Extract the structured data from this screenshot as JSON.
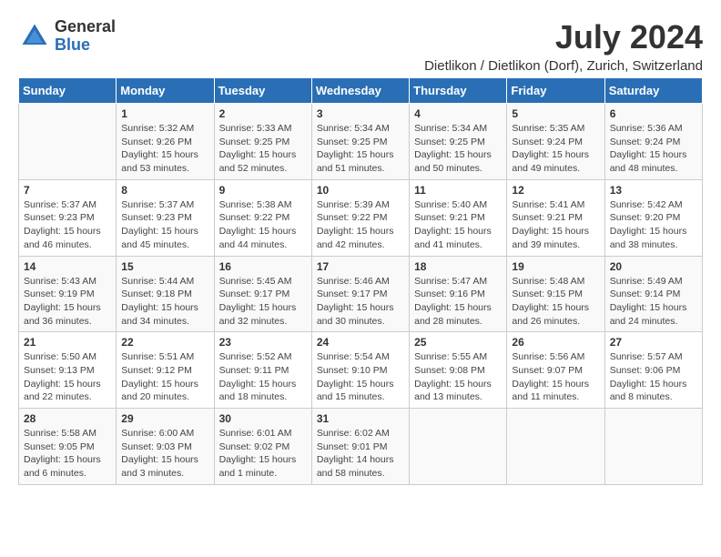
{
  "header": {
    "logo_general": "General",
    "logo_blue": "Blue",
    "title": "July 2024",
    "subtitle": "Dietlikon / Dietlikon (Dorf), Zurich, Switzerland"
  },
  "days_of_week": [
    "Sunday",
    "Monday",
    "Tuesday",
    "Wednesday",
    "Thursday",
    "Friday",
    "Saturday"
  ],
  "weeks": [
    [
      {
        "day": "",
        "content": ""
      },
      {
        "day": "1",
        "content": "Sunrise: 5:32 AM\nSunset: 9:26 PM\nDaylight: 15 hours\nand 53 minutes."
      },
      {
        "day": "2",
        "content": "Sunrise: 5:33 AM\nSunset: 9:25 PM\nDaylight: 15 hours\nand 52 minutes."
      },
      {
        "day": "3",
        "content": "Sunrise: 5:34 AM\nSunset: 9:25 PM\nDaylight: 15 hours\nand 51 minutes."
      },
      {
        "day": "4",
        "content": "Sunrise: 5:34 AM\nSunset: 9:25 PM\nDaylight: 15 hours\nand 50 minutes."
      },
      {
        "day": "5",
        "content": "Sunrise: 5:35 AM\nSunset: 9:24 PM\nDaylight: 15 hours\nand 49 minutes."
      },
      {
        "day": "6",
        "content": "Sunrise: 5:36 AM\nSunset: 9:24 PM\nDaylight: 15 hours\nand 48 minutes."
      }
    ],
    [
      {
        "day": "7",
        "content": "Sunrise: 5:37 AM\nSunset: 9:23 PM\nDaylight: 15 hours\nand 46 minutes."
      },
      {
        "day": "8",
        "content": "Sunrise: 5:37 AM\nSunset: 9:23 PM\nDaylight: 15 hours\nand 45 minutes."
      },
      {
        "day": "9",
        "content": "Sunrise: 5:38 AM\nSunset: 9:22 PM\nDaylight: 15 hours\nand 44 minutes."
      },
      {
        "day": "10",
        "content": "Sunrise: 5:39 AM\nSunset: 9:22 PM\nDaylight: 15 hours\nand 42 minutes."
      },
      {
        "day": "11",
        "content": "Sunrise: 5:40 AM\nSunset: 9:21 PM\nDaylight: 15 hours\nand 41 minutes."
      },
      {
        "day": "12",
        "content": "Sunrise: 5:41 AM\nSunset: 9:21 PM\nDaylight: 15 hours\nand 39 minutes."
      },
      {
        "day": "13",
        "content": "Sunrise: 5:42 AM\nSunset: 9:20 PM\nDaylight: 15 hours\nand 38 minutes."
      }
    ],
    [
      {
        "day": "14",
        "content": "Sunrise: 5:43 AM\nSunset: 9:19 PM\nDaylight: 15 hours\nand 36 minutes."
      },
      {
        "day": "15",
        "content": "Sunrise: 5:44 AM\nSunset: 9:18 PM\nDaylight: 15 hours\nand 34 minutes."
      },
      {
        "day": "16",
        "content": "Sunrise: 5:45 AM\nSunset: 9:17 PM\nDaylight: 15 hours\nand 32 minutes."
      },
      {
        "day": "17",
        "content": "Sunrise: 5:46 AM\nSunset: 9:17 PM\nDaylight: 15 hours\nand 30 minutes."
      },
      {
        "day": "18",
        "content": "Sunrise: 5:47 AM\nSunset: 9:16 PM\nDaylight: 15 hours\nand 28 minutes."
      },
      {
        "day": "19",
        "content": "Sunrise: 5:48 AM\nSunset: 9:15 PM\nDaylight: 15 hours\nand 26 minutes."
      },
      {
        "day": "20",
        "content": "Sunrise: 5:49 AM\nSunset: 9:14 PM\nDaylight: 15 hours\nand 24 minutes."
      }
    ],
    [
      {
        "day": "21",
        "content": "Sunrise: 5:50 AM\nSunset: 9:13 PM\nDaylight: 15 hours\nand 22 minutes."
      },
      {
        "day": "22",
        "content": "Sunrise: 5:51 AM\nSunset: 9:12 PM\nDaylight: 15 hours\nand 20 minutes."
      },
      {
        "day": "23",
        "content": "Sunrise: 5:52 AM\nSunset: 9:11 PM\nDaylight: 15 hours\nand 18 minutes."
      },
      {
        "day": "24",
        "content": "Sunrise: 5:54 AM\nSunset: 9:10 PM\nDaylight: 15 hours\nand 15 minutes."
      },
      {
        "day": "25",
        "content": "Sunrise: 5:55 AM\nSunset: 9:08 PM\nDaylight: 15 hours\nand 13 minutes."
      },
      {
        "day": "26",
        "content": "Sunrise: 5:56 AM\nSunset: 9:07 PM\nDaylight: 15 hours\nand 11 minutes."
      },
      {
        "day": "27",
        "content": "Sunrise: 5:57 AM\nSunset: 9:06 PM\nDaylight: 15 hours\nand 8 minutes."
      }
    ],
    [
      {
        "day": "28",
        "content": "Sunrise: 5:58 AM\nSunset: 9:05 PM\nDaylight: 15 hours\nand 6 minutes."
      },
      {
        "day": "29",
        "content": "Sunrise: 6:00 AM\nSunset: 9:03 PM\nDaylight: 15 hours\nand 3 minutes."
      },
      {
        "day": "30",
        "content": "Sunrise: 6:01 AM\nSunset: 9:02 PM\nDaylight: 15 hours\nand 1 minute."
      },
      {
        "day": "31",
        "content": "Sunrise: 6:02 AM\nSunset: 9:01 PM\nDaylight: 14 hours\nand 58 minutes."
      },
      {
        "day": "",
        "content": ""
      },
      {
        "day": "",
        "content": ""
      },
      {
        "day": "",
        "content": ""
      }
    ]
  ]
}
